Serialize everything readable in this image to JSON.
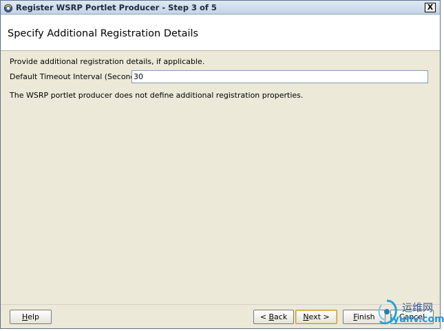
{
  "window": {
    "title": "Register WSRP Portlet Producer - Step 3 of 5",
    "close_label": "X"
  },
  "header": {
    "title": "Specify Additional Registration Details"
  },
  "content": {
    "intro": "Provide additional registration details, if applicable.",
    "timeout_label": "Default Timeout Interval (Seconds):",
    "timeout_value": "30",
    "note": "The WSRP portlet producer does not define additional registration properties."
  },
  "buttons": {
    "help": {
      "prefix": "",
      "mnemonic": "H",
      "suffix": "elp"
    },
    "back": {
      "prefix": "< ",
      "mnemonic": "B",
      "suffix": "ack"
    },
    "next": {
      "prefix": "",
      "mnemonic": "N",
      "suffix": "ext >"
    },
    "finish": {
      "prefix": "",
      "mnemonic": "F",
      "suffix": "inish"
    },
    "cancel": {
      "label": "Cancel"
    }
  },
  "watermark": {
    "cn": "运维网",
    "en": "iyunv.com"
  },
  "colors": {
    "titlebar": "#c3d3e6",
    "dialog_bg": "#ece9d8",
    "header_bg": "#ffffff",
    "next_focus": "#f0c86a"
  }
}
